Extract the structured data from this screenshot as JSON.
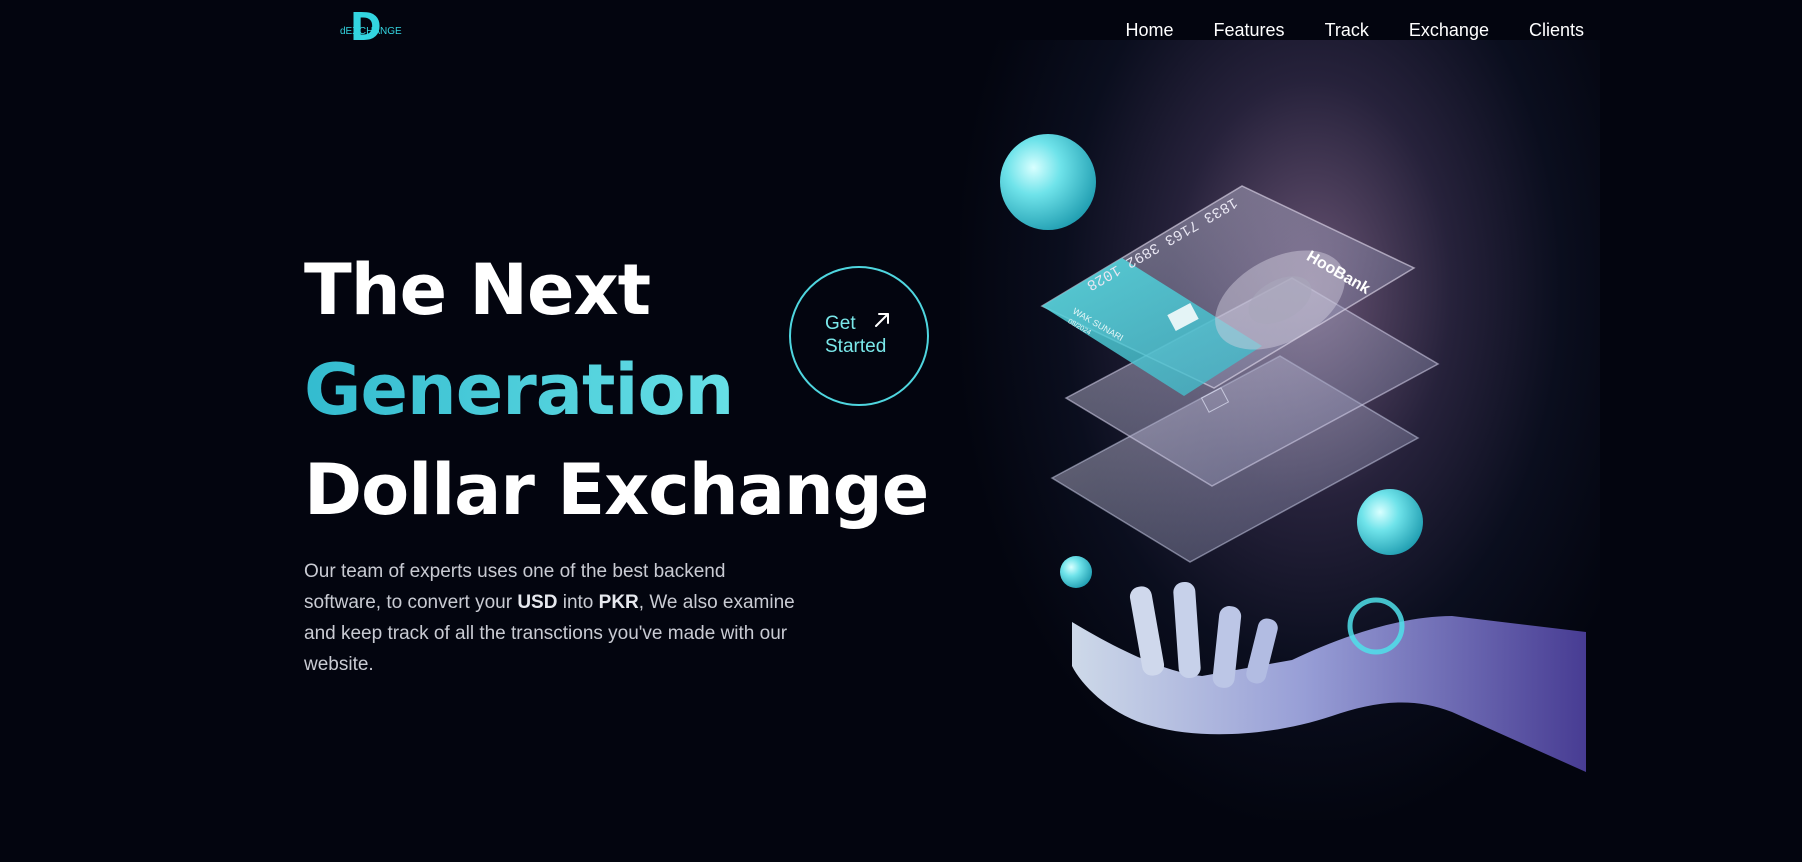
{
  "logo": {
    "letter": "D",
    "text": "dEXCHANGE"
  },
  "nav": {
    "items": [
      {
        "label": "Home"
      },
      {
        "label": "Features"
      },
      {
        "label": "Track"
      },
      {
        "label": "Exchange"
      },
      {
        "label": "Clients"
      }
    ]
  },
  "hero": {
    "line1": "The Next",
    "line2": "Generation",
    "line3": "Dollar Exchange",
    "description": {
      "part1": "Our team of experts uses one of the best backend software, to convert your ",
      "usd": "USD",
      "part2": " into ",
      "pkr": "PKR",
      "part3": ", We also examine and keep track of all the transctions you've made with our website."
    }
  },
  "cta": {
    "label": "Get Started",
    "icon": "arrow-up-right-icon"
  },
  "card": {
    "brand": "HooBank",
    "number": "1833 7163 3892 1028",
    "holder": "WAK SUNARI",
    "holder_small": "08/2024"
  },
  "colors": {
    "background": "#03050f",
    "accent": "#33d5e0",
    "text": "#ffffff",
    "muted": "#c9cbd3"
  }
}
